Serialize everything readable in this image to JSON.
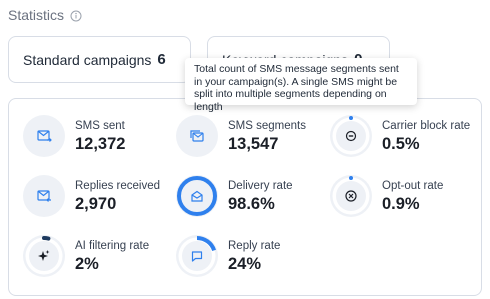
{
  "header": {
    "title": "Statistics",
    "info_icon": "info-circle-icon"
  },
  "campaigns": {
    "standard": {
      "label": "Standard campaigns",
      "count": "6"
    },
    "keyword": {
      "label": "Keyword campaigns",
      "count": "0"
    }
  },
  "tooltip": {
    "text": "Total count of SMS message segments sent in your campaign(s). A single SMS might be split into multiple segments depending on length"
  },
  "colors": {
    "accent": "#2f80ed",
    "icon_bg": "#eef1f6",
    "ring_track": "#eef1f6",
    "border": "#d8dde6"
  },
  "stats": [
    {
      "label": "SMS sent",
      "value": "12,372",
      "icon": "envelope-send-icon",
      "progress": null
    },
    {
      "label": "SMS segments",
      "value": "13,547",
      "icon": "segments-icon",
      "progress": null
    },
    {
      "label": "Carrier block rate",
      "value": "0.5%",
      "icon": "block-icon",
      "progress": 0.005
    },
    {
      "label": "Replies received",
      "value": "2,970",
      "icon": "envelope-reply-icon",
      "progress": null
    },
    {
      "label": "Delivery rate",
      "value": "98.6%",
      "icon": "open-envelope-icon",
      "progress": 0.986
    },
    {
      "label": "Opt-out rate",
      "value": "0.9%",
      "icon": "cancel-circle-icon",
      "progress": 0.009
    },
    {
      "label": "AI filtering rate",
      "value": "2%",
      "icon": "sparkle-icon",
      "progress": 0.02
    },
    {
      "label": "Reply rate",
      "value": "24%",
      "icon": "chat-bubble-icon",
      "progress": 0.24
    }
  ]
}
